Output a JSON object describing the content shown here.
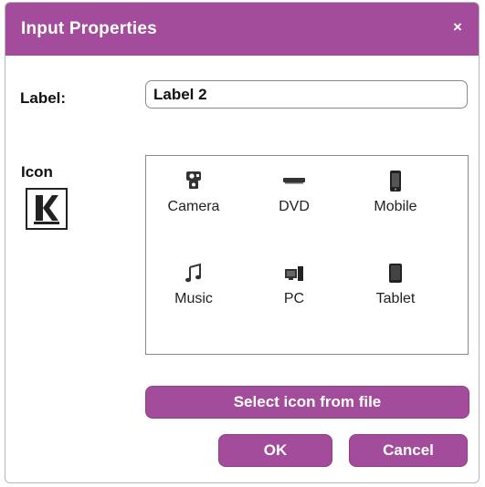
{
  "dialog": {
    "title": "Input Properties",
    "close_glyph": "×"
  },
  "label_field": {
    "caption": "Label:",
    "value": "Label 2"
  },
  "icon_section": {
    "caption": "Icon",
    "selected_icon": "kramer-logo-icon",
    "options": [
      {
        "label": "Camera",
        "icon": "camera-icon"
      },
      {
        "label": "DVD",
        "icon": "dvd-icon"
      },
      {
        "label": "Mobile",
        "icon": "mobile-icon"
      },
      {
        "label": "Music",
        "icon": "music-icon"
      },
      {
        "label": "PC",
        "icon": "pc-icon"
      },
      {
        "label": "Tablet",
        "icon": "tablet-icon"
      }
    ]
  },
  "buttons": {
    "select_file": "Select icon from file",
    "ok": "OK",
    "cancel": "Cancel"
  },
  "colors": {
    "accent": "#a24c9b",
    "text": "#111111"
  }
}
